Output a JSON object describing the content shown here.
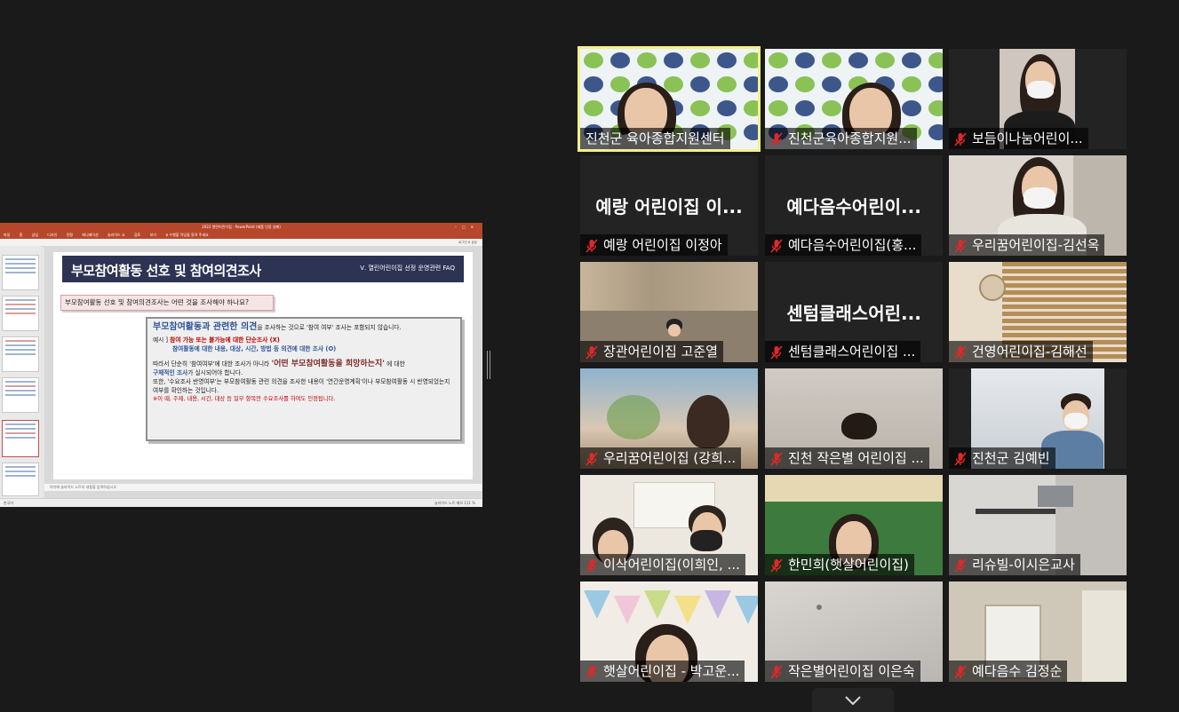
{
  "shared_screen": {
    "window_title": "2022 열린어린이집 - PowerPoint (제품 인증 실패)",
    "ribbon_tabs": [
      "파일",
      "홈",
      "삽입",
      "디자인",
      "전환",
      "애니메이션",
      "슬라이드 쇼",
      "검토",
      "보기",
      "♀ 수행할 작업을 알려 주세요"
    ],
    "account": "로그인  ♀ 공유",
    "slide": {
      "title": "부모참여활동 선호 및 참여의견조사",
      "section": "Ⅴ. 열린어린이집 선정 운영관련 FAQ",
      "question": "부모참여활동 선호 및 참여의견조사는 어떤 것을 조사해야 하나요?",
      "answer_lead": "부모참여활동과 관련한 의견",
      "answer_lead_rest": "을 조사하는 것으로 '참여 여부' 조사는 포함되지 않습니다.",
      "example_label": "예시 ] ",
      "example_bad": "참여 가능 또는 불가능에 대한 단순조사 (X)",
      "example_good": "참여활동에 대한 내용, 대상, 시간, 방법 등 의견에 대한 조사 (O)",
      "para1_a": "따라서 단순히 '참여여부'에 대한 조사가 아니라 ",
      "para1_emph": "'어떤 부모참여활동을 희망하는지'",
      "para1_b": " 에 대한",
      "para1_c_emph": "구체적인 조사",
      "para1_c": "가 실시되어야 합니다.",
      "para2": "또한, '수요조사 반영여부'는 부모참여활동 관련 의견을 조사한 내용이 '연간운영계획'이나 부모참여활동 시 반영되었는지 여부를 확인하는 것입니다.",
      "note": "※이 때, 주제, 내용, 시간, 대상 등 일부 항목만 수요조사를 하여도 인정됩니다."
    },
    "notes_placeholder": "여기에 슬라이드 노트의 내용을 입력하십시오",
    "status_left": "한국어",
    "status_right": "슬라이드 노트   메모        111 %"
  },
  "gallery": [
    {
      "name": "진천군 육아종합지원센터",
      "muted": false,
      "video": "banner",
      "active": true
    },
    {
      "name": "진천군육아종합지원...",
      "muted": true,
      "video": "banner2",
      "active": false
    },
    {
      "name": "보듬이나눔어린이...",
      "muted": true,
      "video": "woman-mask",
      "active": false
    },
    {
      "name": "예랑 어린이집 이정아",
      "muted": true,
      "video": "none",
      "display_name": "예랑 어린이집 이...",
      "active": false
    },
    {
      "name": "예다음수어린이집(홍...",
      "muted": true,
      "video": "none",
      "display_name": "예다음수어린이...",
      "active": false
    },
    {
      "name": "우리꿈어린이집-김선옥",
      "muted": true,
      "video": "woman-mask2",
      "active": false
    },
    {
      "name": "장관어린이집 고준열",
      "muted": true,
      "video": "blur-room",
      "active": false
    },
    {
      "name": "센텀클래스어린이집 ...",
      "muted": true,
      "video": "none",
      "display_name": "센텀클래스어린...",
      "active": false
    },
    {
      "name": "건영어린이집-김해선",
      "muted": true,
      "video": "blinds",
      "active": false
    },
    {
      "name": "우리꿈어린이집 (강희...",
      "muted": true,
      "video": "blur-class",
      "active": false
    },
    {
      "name": "진천 작은별 어린이집 ...",
      "muted": true,
      "video": "ceiling-head",
      "active": false
    },
    {
      "name": "진천군 김예빈",
      "muted": true,
      "video": "man-mask",
      "active": false
    },
    {
      "name": "이삭어린이집(이희인, ...",
      "muted": true,
      "video": "class-kids",
      "active": false
    },
    {
      "name": "한민희(햇살어린이집)",
      "muted": true,
      "video": "woman-green",
      "active": false
    },
    {
      "name": "리슈빌-이시은교사",
      "muted": true,
      "video": "shelf",
      "active": false
    },
    {
      "name": "햇살어린이집 - 박고운...",
      "muted": true,
      "video": "bunting",
      "active": false
    },
    {
      "name": "작은별어린이집 이은숙",
      "muted": true,
      "video": "ceiling",
      "active": false
    },
    {
      "name": "예다음수 김정순",
      "muted": true,
      "video": "door",
      "active": false
    }
  ],
  "colors": {
    "background": "#1a1a1a",
    "active_speaker": "#f3f08a",
    "muted_icon": "#e02828",
    "ppt_accent": "#b7472a"
  }
}
